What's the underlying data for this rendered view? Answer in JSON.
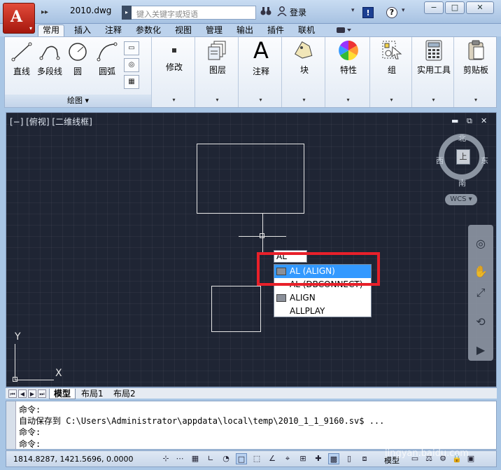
{
  "window": {
    "doc_title": "2010.dwg",
    "search_placeholder": "键入关键字或短语",
    "login_label": "登录",
    "info_label": "!",
    "help_label": "?",
    "minimize": "−",
    "restore": "□",
    "close": "✕"
  },
  "ribbon_tabs": [
    "常用",
    "插入",
    "注释",
    "参数化",
    "视图",
    "管理",
    "输出",
    "插件",
    "联机"
  ],
  "ribbon": {
    "draw_tools": [
      "直线",
      "多段线",
      "圆",
      "圆弧"
    ],
    "draw_panel_title": "绘图",
    "modify_label": "修改",
    "layers_label": "图层",
    "annotation_label": "注释",
    "annotation_glyph": "A",
    "block_label": "块",
    "properties_label": "特性",
    "group_label": "组",
    "utilities_label": "实用工具",
    "clipboard_label": "剪贴板"
  },
  "viewport": {
    "label": "[−] [俯视] [二维线框]",
    "viewcube": {
      "top_face": "上",
      "north": "北",
      "south": "南",
      "west": "西",
      "east": "东"
    },
    "wcs_label": "WCS",
    "typed_text": "AL",
    "autocomplete": [
      "AL (ALIGN)",
      "AL (DBCONNECT)",
      "ALIGN",
      "ALLPLAY"
    ],
    "ucs_x": "X",
    "ucs_y": "Y"
  },
  "layout_tabs": [
    "模型",
    "布局1",
    "布局2"
  ],
  "command_lines": [
    "命令:",
    "自动保存到 C:\\Users\\Administrator\\appdata\\local\\temp\\2010_1_1_9160.sv$ ...",
    "命令:",
    "命令:"
  ],
  "status": {
    "coordinates": "1814.8287, 1421.5696, 0.0000",
    "model_label": "模型"
  },
  "watermark": "jingyan.baidu.com",
  "colors": {
    "highlight": "#e8202a",
    "selection": "#3399ff",
    "canvas": "#1f2534"
  }
}
